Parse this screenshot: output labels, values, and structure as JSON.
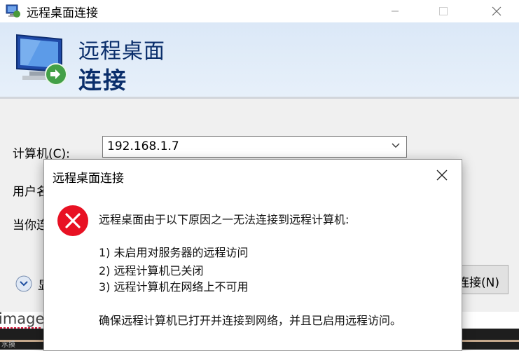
{
  "window": {
    "title": "远程桌面连接",
    "icon": "remote-desktop-icon",
    "controls": [
      "minimize-icon",
      "maximize-icon",
      "close-icon"
    ]
  },
  "banner": {
    "line1": "远程桌面",
    "line2": "连接",
    "icon": "monitor-connection-icon",
    "color": "#0a2e6b"
  },
  "form": {
    "computer_label": "计算机(C):",
    "computer_value": "192.168.1.7",
    "user_label_partial": "用户名",
    "when_label_partial": "当你连",
    "options_label_partial": "显",
    "connect_button_partial": "连接(N)"
  },
  "background_strip": {
    "text": "images",
    "taskbar_text": "水摸"
  },
  "dialog": {
    "title": "远程桌面连接",
    "message": "远程桌面由于以下原因之一无法连接到远程计算机:",
    "reasons": [
      "1) 未启用对服务器的远程访问",
      "2) 远程计算机已关闭",
      "3) 远程计算机在网络上不可用"
    ],
    "advice": "确保远程计算机已打开并连接到网络，并且已启用远程访问。",
    "icon": "error-icon",
    "error_color": "#e81123"
  }
}
